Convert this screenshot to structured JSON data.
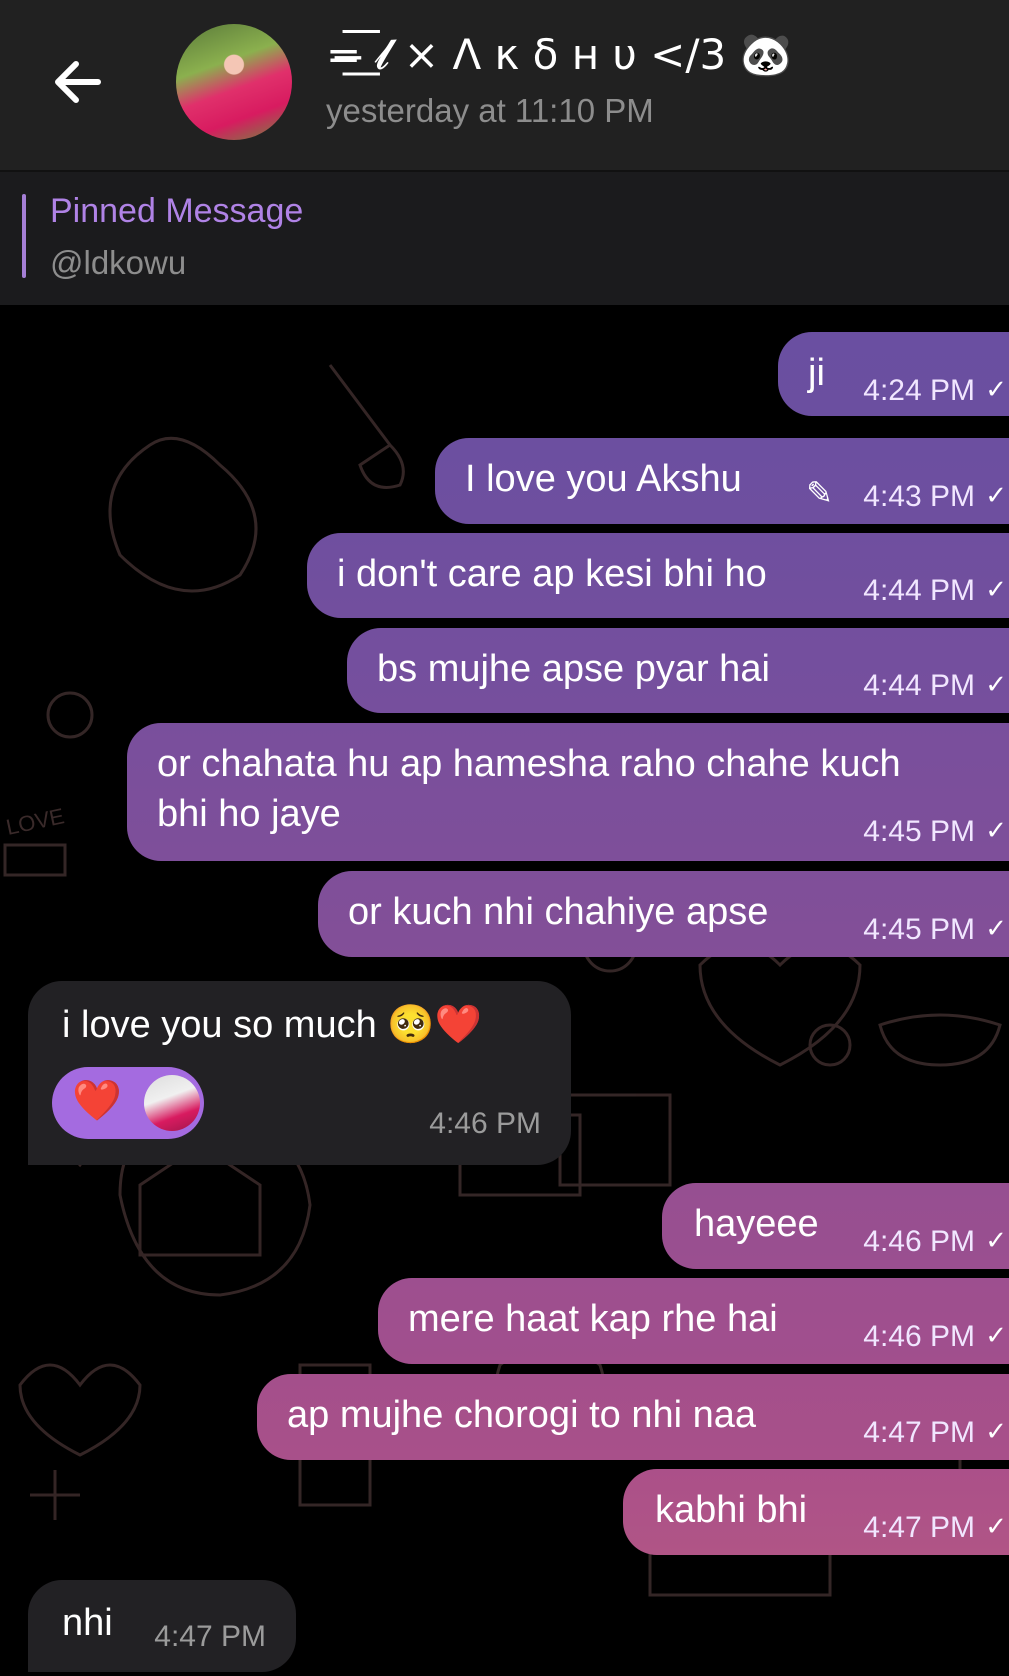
{
  "header": {
    "contact_name": "=̶͟͞ 𝓵 × Λ κ δ н υ </3 🐼",
    "status": "yesterday at 11:10 PM"
  },
  "pinned": {
    "title": "Pinned Message",
    "text": "@ldkowu"
  },
  "messages": [
    {
      "dir": "out",
      "text": "ji",
      "time": "4:24 PM",
      "read": "✓"
    },
    {
      "dir": "out",
      "text": "I love you Akshu",
      "time": "4:43 PM",
      "edited": "✎",
      "read": "✓"
    },
    {
      "dir": "out",
      "text": "i don't care ap kesi bhi ho",
      "time": "4:44 PM",
      "read": "✓"
    },
    {
      "dir": "out",
      "text": "bs mujhe apse pyar hai",
      "time": "4:44 PM",
      "read": "✓"
    },
    {
      "dir": "out",
      "text_line1": "or chahata hu ap hamesha raho chahe kuch",
      "text_line2": "bhi ho jaye",
      "time": "4:45 PM",
      "read": "✓"
    },
    {
      "dir": "out",
      "text": "or kuch nhi chahiye apse",
      "time": "4:45 PM",
      "read": "✓"
    },
    {
      "dir": "in",
      "text": "i love you so much 🥺❤️",
      "time": "4:46 PM",
      "reaction": "❤️"
    },
    {
      "dir": "out",
      "text": "hayeee",
      "time": "4:46 PM",
      "read": "✓"
    },
    {
      "dir": "out",
      "text": "mere haat kap rhe hai",
      "time": "4:46 PM",
      "read": "✓"
    },
    {
      "dir": "out",
      "text": "ap mujhe chorogi to nhi naa",
      "time": "4:47 PM",
      "read": "✓"
    },
    {
      "dir": "out",
      "text": "kabhi bhi",
      "time": "4:47 PM",
      "read": "✓"
    },
    {
      "dir": "in",
      "text": "nhi",
      "time": "4:47 PM"
    }
  ],
  "doodle_label": "LOVE",
  "colors": {
    "header_bg": "#212121",
    "accent": "#b083e6",
    "bubble_out_top": "#6b4fa0",
    "bubble_out_bottom": "#b25683",
    "bubble_in": "#222124"
  }
}
